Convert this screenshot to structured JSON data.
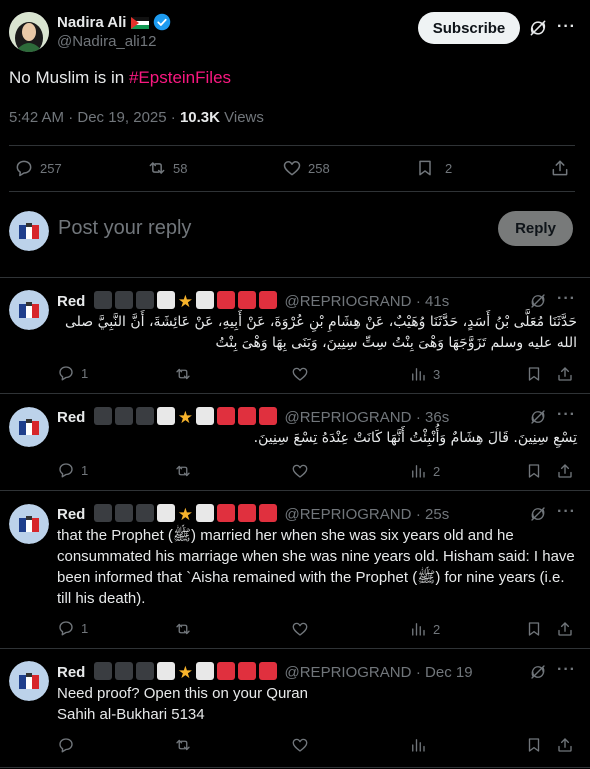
{
  "post": {
    "author_name": "Nadira Ali",
    "handle": "@Nadira_ali12",
    "subscribe_label": "Subscribe",
    "text_prefix": "No Muslim is in ",
    "hashtag": "#EpsteinFiles",
    "time": "5:42 AM · Dec 19, 2025 · ",
    "views_count": "10.3K",
    "views_label": " Views",
    "stats": {
      "replies": "257",
      "reposts": "58",
      "likes": "258",
      "bookmarks": "2"
    }
  },
  "composer": {
    "placeholder": "Post your reply",
    "reply_button": "Reply"
  },
  "replies": [
    {
      "name": "Red",
      "handle": "@REPRIOGRAND",
      "time": "· 41s",
      "text": "حَدَّثَنَا مُعَلَّى بْنُ أَسَدٍ، حَدَّثَنَا وُهَيْبٌ، عَنْ هِشَامِ بْنِ عُرْوَةَ، عَنْ أَبِيهِ، عَنْ عَائِشَةَ، أَنَّ النَّبِيَّ صلى الله عليه وسلم تَزَوَّجَهَا وَهْىَ بِنْتُ سِتِّ سِنِينَ، وَبَنَى بِهَا وَهْىَ بِنْتُ",
      "replies": "1",
      "views": "3"
    },
    {
      "name": "Red",
      "handle": "@REPRIOGRAND",
      "time": "· 36s",
      "text": "تِسْعِ سِنِينَ. قَالَ هِشَامٌ وَأُنْبِئْتُ أَنَّهَا كَانَتْ عِنْدَهُ تِسْعَ سِنِينَ.",
      "replies": "1",
      "views": "2"
    },
    {
      "name": "Red",
      "handle": "@REPRIOGRAND",
      "time": "· 25s",
      "text": "that the Prophet (ﷺ) married her when she was six years old and he consummated his marriage when she was nine years old. Hisham said: I have been informed that `Aisha remained with the Prophet (ﷺ) for nine years (i.e. till his death).",
      "replies": "1",
      "views": "2"
    },
    {
      "name": "Red",
      "handle": "@REPRIOGRAND",
      "time": "· Dec 19",
      "text_line1": "Need proof? Open this on your Quran",
      "text_line2": "Sahih al-Bukhari 5134"
    }
  ],
  "colors": {
    "accent": "#f91880",
    "verified": "#1d9bf0",
    "background": "#000000",
    "muted": "#71767b"
  }
}
